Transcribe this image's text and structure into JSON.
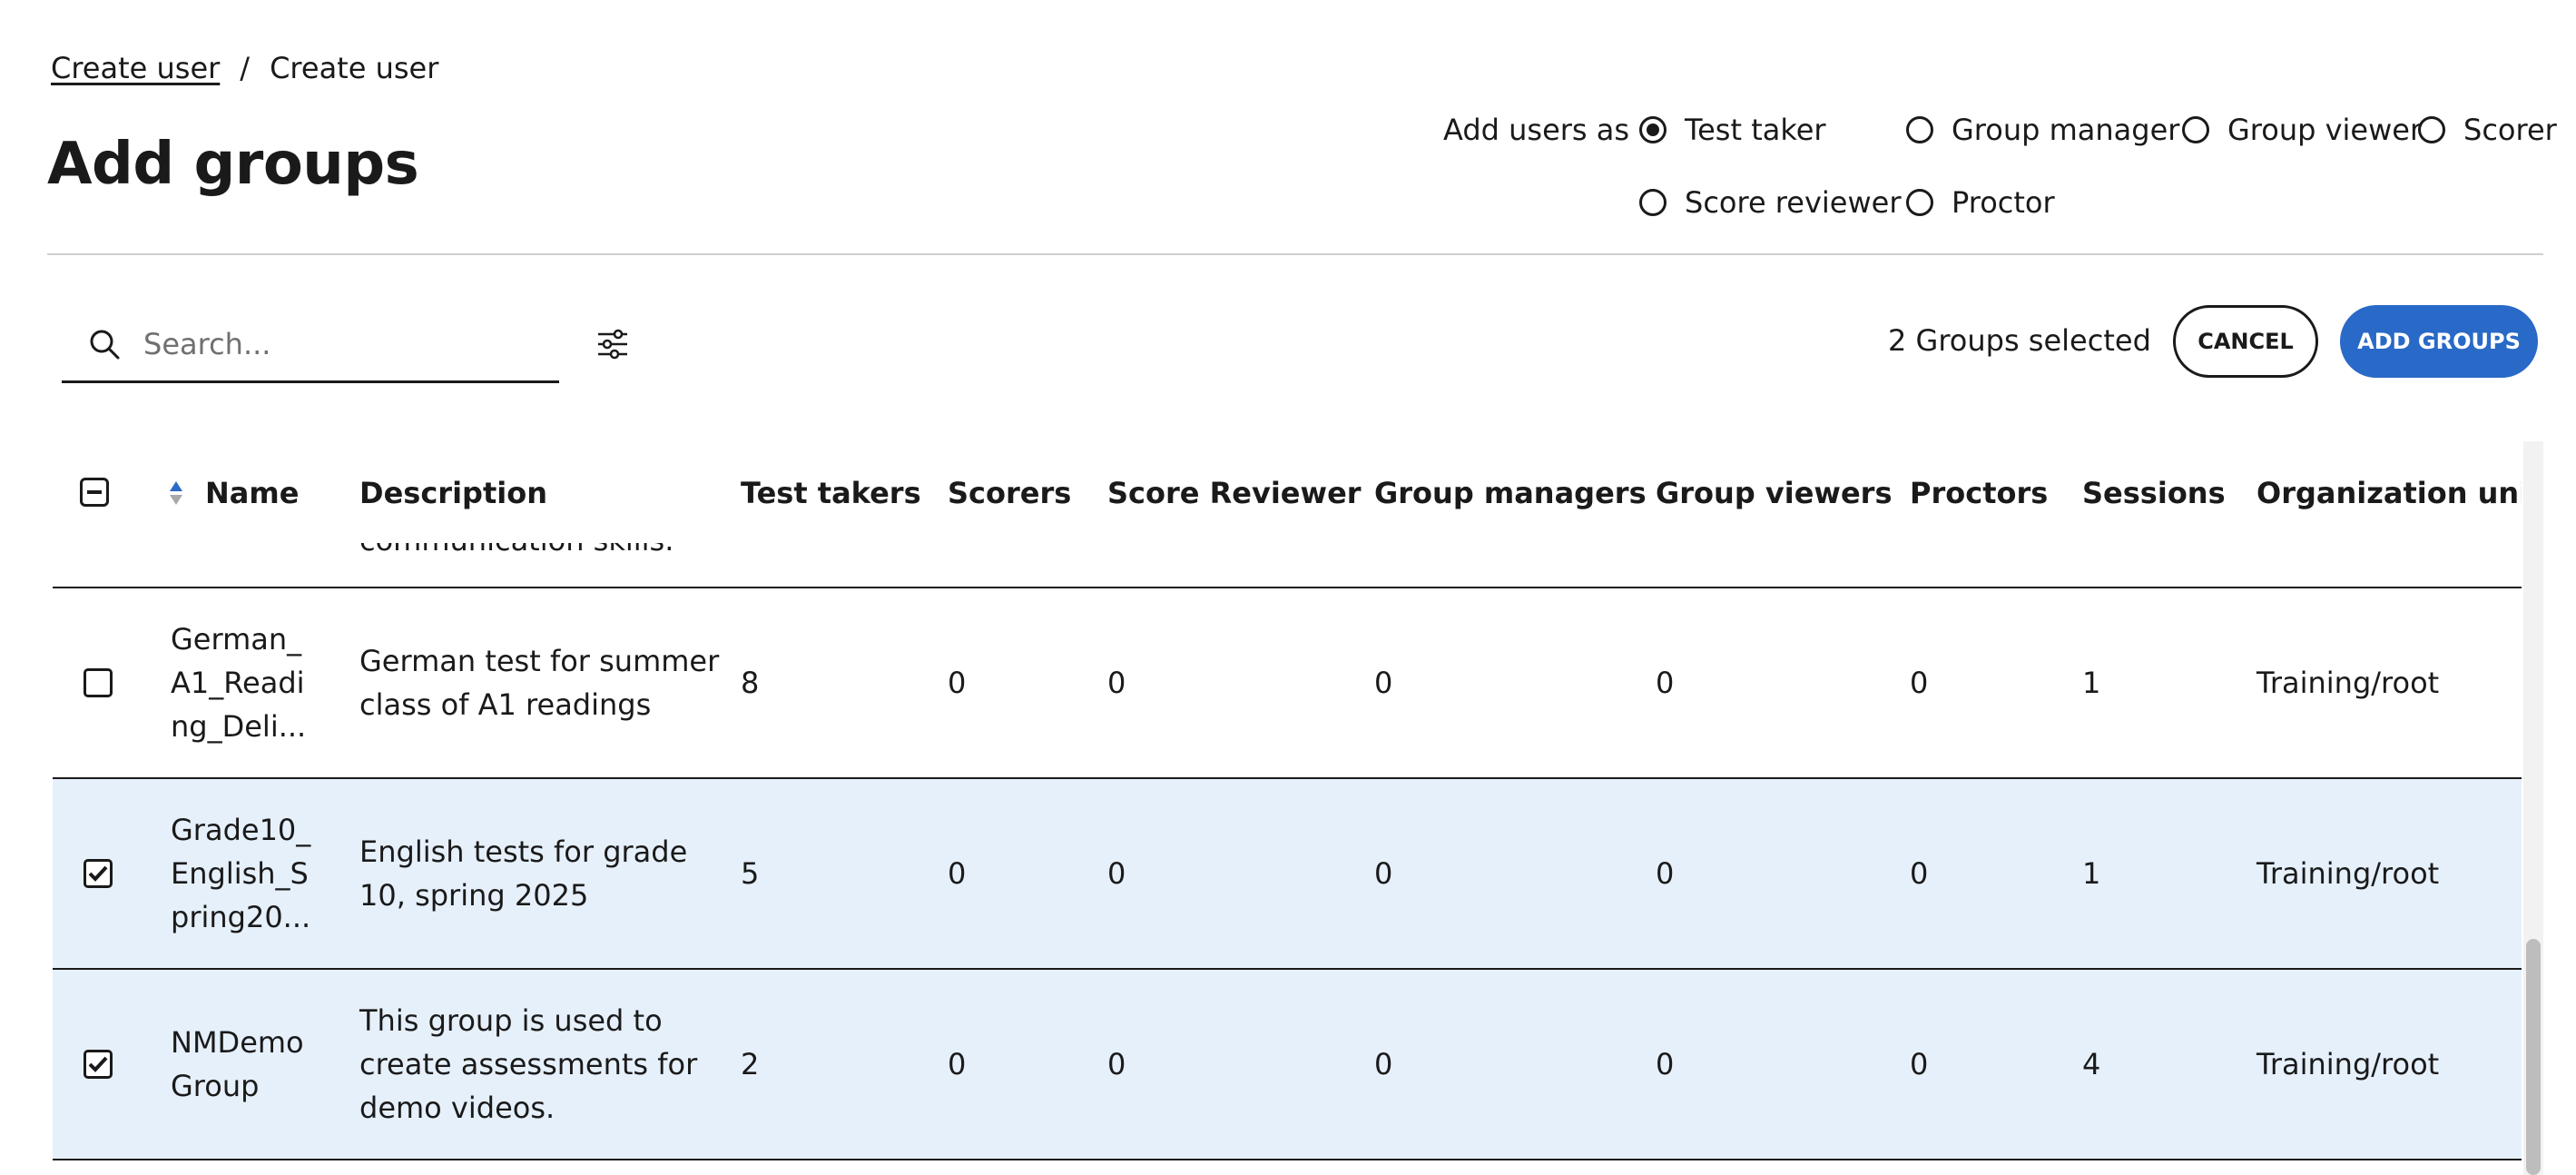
{
  "breadcrumb": {
    "link": "Create user",
    "separator": "/",
    "current": "Create user"
  },
  "page_title": "Add groups",
  "roles": {
    "label": "Add users as",
    "options": [
      "Test taker",
      "Group manager",
      "Group viewer",
      "Scorer",
      "Score reviewer",
      "Proctor"
    ],
    "selected": "Test taker"
  },
  "search": {
    "placeholder": "Search...",
    "value": ""
  },
  "toolbar": {
    "selected_count": "2 Groups selected",
    "cancel_label": "CANCEL",
    "add_label": "ADD GROUPS"
  },
  "table": {
    "columns": [
      "Name",
      "Description",
      "Test takers",
      "Scorers",
      "Score Reviewer",
      "Group managers",
      "Group viewers",
      "Proctors",
      "Sessions",
      "Organization unit"
    ],
    "clipped_prev_row_text": "communication skills.",
    "rows": [
      {
        "name_lines": [
          "German_",
          "A1_Readi",
          "ng_Deli..."
        ],
        "desc_lines": [
          "German test for summer",
          "class of A1 readings"
        ],
        "test_takers": "8",
        "scorers": "0",
        "score_reviewer": "0",
        "group_managers": "0",
        "group_viewers": "0",
        "proctors": "0",
        "sessions": "1",
        "org_unit": "Training/root",
        "checked": false
      },
      {
        "name_lines": [
          "Grade10_",
          "English_S",
          "pring20..."
        ],
        "desc_lines": [
          "English tests for grade",
          "10, spring 2025"
        ],
        "test_takers": "5",
        "scorers": "0",
        "score_reviewer": "0",
        "group_managers": "0",
        "group_viewers": "0",
        "proctors": "0",
        "sessions": "1",
        "org_unit": "Training/root",
        "checked": true
      },
      {
        "name_lines": [
          "NMDemo",
          "Group"
        ],
        "desc_lines": [
          "This group is used to",
          "create assessments for",
          "demo videos."
        ],
        "test_takers": "2",
        "scorers": "0",
        "score_reviewer": "0",
        "group_managers": "0",
        "group_viewers": "0",
        "proctors": "0",
        "sessions": "4",
        "org_unit": "Training/root",
        "checked": true
      }
    ]
  },
  "colors": {
    "accent": "#2969c7",
    "selected_row": "#e6f0fb",
    "sort_up": "#2969c7",
    "sort_down": "#a8a8a8"
  }
}
